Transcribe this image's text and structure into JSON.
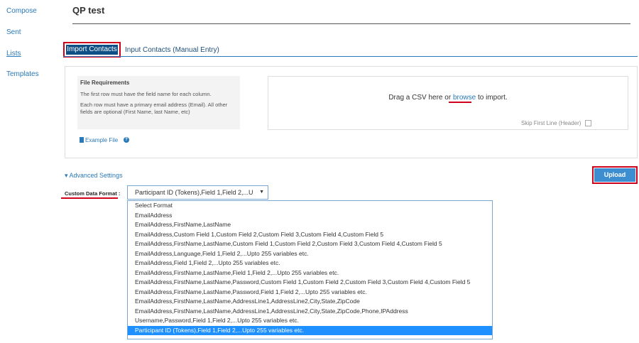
{
  "sidebar": {
    "items": [
      {
        "label": "Compose"
      },
      {
        "label": "Sent"
      },
      {
        "label": "Lists"
      },
      {
        "label": "Templates"
      }
    ]
  },
  "page": {
    "title": "QP test"
  },
  "tabs": {
    "import_label": "Import Contacts",
    "manual_label": "Input Contacts (Manual Entry)"
  },
  "requirements": {
    "heading": "File Requirements",
    "line1": "The first row must have the field name for each column.",
    "line2": "Each row must have a primary email address (Email). All other fields are optional (First Name, last Name, etc)"
  },
  "dropzone": {
    "text_before": "Drag a CSV here or ",
    "link": "browse",
    "text_after": " to import.",
    "skip_label": "Skip First Line (Header)"
  },
  "example_file": "Example File",
  "help_icon": "?",
  "advanced": {
    "label": "▾ Advanced Settings"
  },
  "upload_label": "Upload",
  "custom_format": {
    "label": "Custom Data Format :",
    "selected": "Participant ID (Tokens),Field 1,Field 2,...U",
    "caret": "▼",
    "options": [
      "Select Format",
      "EmailAddress",
      "EmailAddress,FirstName,LastName",
      "EmailAddress,Custom Field 1,Custom Field 2,Custom Field 3,Custom Field 4,Custom Field 5",
      "EmailAddress,FirstName,LastName,Custom Field 1,Custom Field 2,Custom Field 3,Custom Field 4,Custom Field 5",
      "EmailAddress,Language,Field 1,Field 2,...Upto 255 variables etc.",
      "EmailAddress,Field 1,Field 2,...Upto 255 variables etc.",
      "EmailAddress,FirstName,LastName,Field 1,Field 2,...Upto 255 variables etc.",
      "EmailAddress,FirstName,LastName,Password,Custom Field 1,Custom Field 2,Custom Field 3,Custom Field 4,Custom Field 5",
      "EmailAddress,FirstName,LastName,Password,Field 1,Field 2,...Upto 255 variables etc.",
      "EmailAddress,FirstName,LastName,AddressLine1,AddressLine2,City,State,ZipCode",
      "EmailAddress,FirstName,LastName,AddressLine1,AddressLine2,City,State,ZipCode,Phone,IPAddress",
      "Username,Password,Field 1,Field 2,...Upto 255 variables etc.",
      "Participant ID (Tokens),Field 1,Field 2,...Upto 255 variables etc."
    ]
  }
}
